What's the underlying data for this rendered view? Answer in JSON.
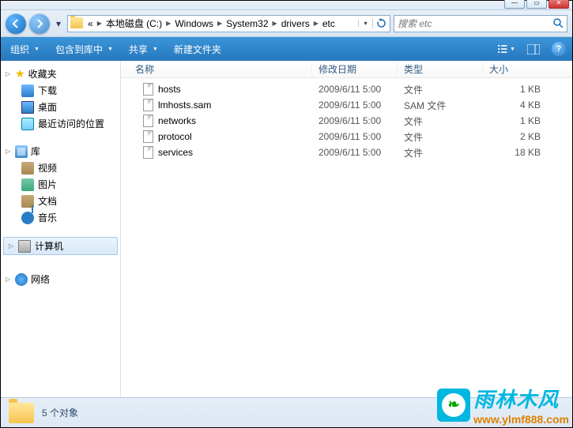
{
  "window_controls": {
    "min": "—",
    "max": "▭",
    "close": "✕"
  },
  "breadcrumb": {
    "chev": "«",
    "segments": [
      "本地磁盘 (C:)",
      "Windows",
      "System32",
      "drivers",
      "etc"
    ]
  },
  "search": {
    "placeholder": "搜索 etc"
  },
  "toolbar": {
    "organize": "组织",
    "include": "包含到库中",
    "share": "共享",
    "newfolder": "新建文件夹"
  },
  "sidebar": {
    "favorites": {
      "label": "收藏夹",
      "items": [
        "下载",
        "桌面",
        "最近访问的位置"
      ]
    },
    "libraries": {
      "label": "库",
      "items": [
        "视频",
        "图片",
        "文档",
        "音乐"
      ]
    },
    "computer": {
      "label": "计算机"
    },
    "network": {
      "label": "网络"
    }
  },
  "columns": {
    "name": "名称",
    "date": "修改日期",
    "type": "类型",
    "size": "大小"
  },
  "files": [
    {
      "name": "hosts",
      "date": "2009/6/11 5:00",
      "type": "文件",
      "size": "1 KB"
    },
    {
      "name": "lmhosts.sam",
      "date": "2009/6/11 5:00",
      "type": "SAM 文件",
      "size": "4 KB"
    },
    {
      "name": "networks",
      "date": "2009/6/11 5:00",
      "type": "文件",
      "size": "1 KB"
    },
    {
      "name": "protocol",
      "date": "2009/6/11 5:00",
      "type": "文件",
      "size": "2 KB"
    },
    {
      "name": "services",
      "date": "2009/6/11 5:00",
      "type": "文件",
      "size": "18 KB"
    }
  ],
  "status": {
    "count": "5 个对象"
  },
  "watermark": {
    "brand": "雨林木风",
    "url": "www.ylmf888.com"
  }
}
